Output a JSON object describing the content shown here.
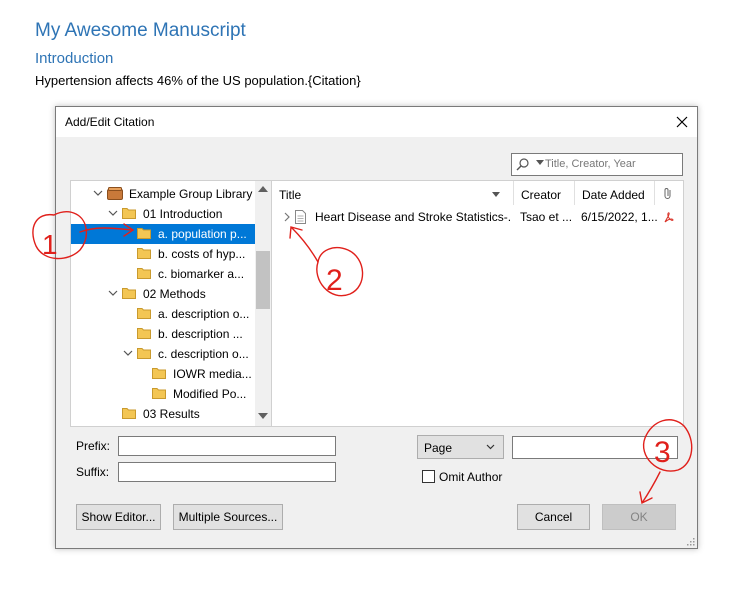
{
  "document": {
    "title": "My Awesome Manuscript",
    "heading": "Introduction",
    "body_text": "Hypertension affects 46% of the US population.{Citation}"
  },
  "dialog": {
    "title": "Add/Edit Citation",
    "search_placeholder": "Title, Creator, Year",
    "tree": [
      {
        "label": "Example Group Library",
        "type": "library"
      },
      {
        "label": "01 Introduction"
      },
      {
        "label": "a. population p...",
        "selected": true
      },
      {
        "label": "b. costs of hyp..."
      },
      {
        "label": "c. biomarker a..."
      },
      {
        "label": "02 Methods"
      },
      {
        "label": "a. description o..."
      },
      {
        "label": "b. description ..."
      },
      {
        "label": "c. description o..."
      },
      {
        "label": "IOWR media..."
      },
      {
        "label": "Modified Po..."
      },
      {
        "label": "03 Results"
      }
    ],
    "columns": {
      "title": "Title",
      "creator": "Creator",
      "date_added": "Date Added"
    },
    "items": [
      {
        "title": "Heart Disease and Stroke Statistics-...",
        "creator": "Tsao et ...",
        "date_added": "6/15/2022, 1..."
      }
    ],
    "prefix_label": "Prefix:",
    "suffix_label": "Suffix:",
    "locator_selected": "Page",
    "omit_author_label": "Omit Author",
    "buttons": {
      "show_editor": "Show Editor...",
      "multiple_sources": "Multiple Sources...",
      "cancel": "Cancel",
      "ok": "OK"
    }
  },
  "annotations": {
    "labels": [
      "1",
      "2",
      "3"
    ],
    "color": "#e0201b"
  },
  "colors": {
    "accent_blue": "#2e74b5",
    "selection": "#0078d7",
    "folder": "#e8b84a"
  }
}
